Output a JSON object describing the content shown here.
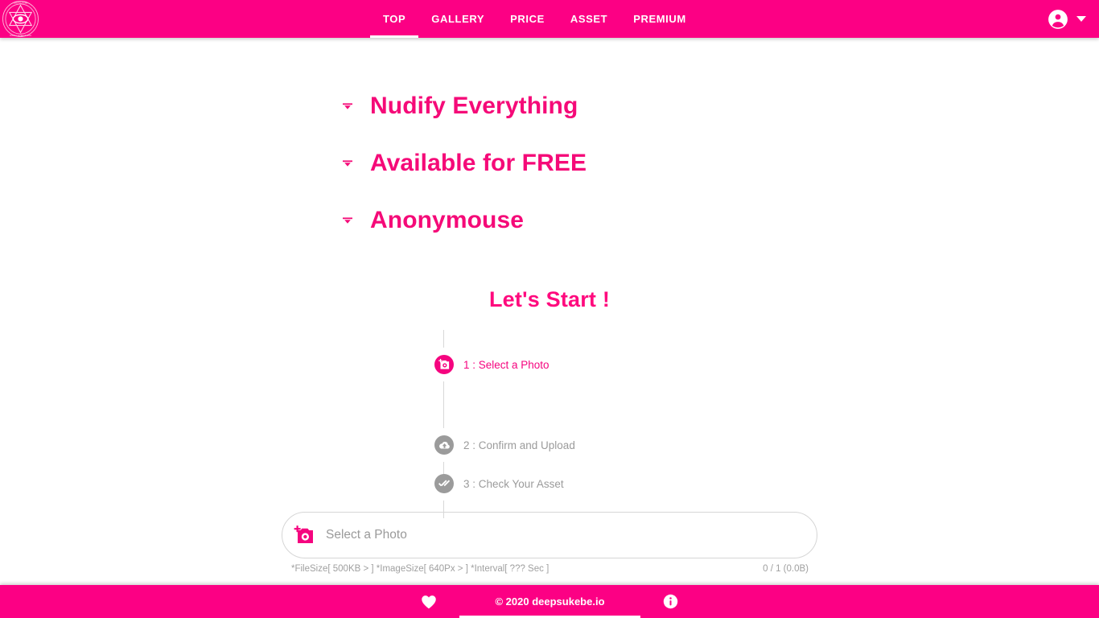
{
  "colors": {
    "brand_pink": "#FC0084",
    "heading_pink": "#F50A78",
    "step_active_pink": "#F5047F",
    "step_inactive_gray": "#9b9b9b",
    "muted_text": "#a0a0a0"
  },
  "header": {
    "logo_icon": "all-seeing-eye-hexagram-logo",
    "nav": [
      {
        "label": "TOP",
        "active": true
      },
      {
        "label": "GALLERY",
        "active": false
      },
      {
        "label": "PRICE",
        "active": false
      },
      {
        "label": "ASSET",
        "active": false
      },
      {
        "label": "PREMIUM",
        "active": false
      }
    ],
    "account": {
      "avatar_icon": "account-circle-icon",
      "caret_icon": "chevron-down-icon"
    }
  },
  "taglines": [
    {
      "marker_icon": "arrow-drop-down-icon",
      "text": "Nudify Everything"
    },
    {
      "marker_icon": "arrow-drop-down-icon",
      "text": "Available for FREE"
    },
    {
      "marker_icon": "arrow-drop-down-icon",
      "text": "Anonymouse"
    }
  ],
  "main": {
    "lets_start_heading": "Let's Start !",
    "steps": [
      {
        "label": "1 : Select a Photo",
        "icon": "add-a-photo-icon",
        "state": "active"
      },
      {
        "label": "2 : Confirm and Upload",
        "icon": "cloud-upload-icon",
        "state": "inactive"
      },
      {
        "label": "3 : Check Your Asset",
        "icon": "double-check-icon",
        "state": "inactive"
      }
    ],
    "file_select": {
      "icon": "add-a-photo-icon",
      "placeholder": "Select a Photo",
      "constraints_text": "*FileSize[ 500KB > ] *ImageSize[ 640Px > ] *Interval[ ??? Sec ]",
      "counter_text": "0 / 1 (0.0B)"
    }
  },
  "footer": {
    "heart_icon": "heart-icon",
    "copyright": "© 2020 deepsukebe.io",
    "info_icon": "info-icon"
  }
}
